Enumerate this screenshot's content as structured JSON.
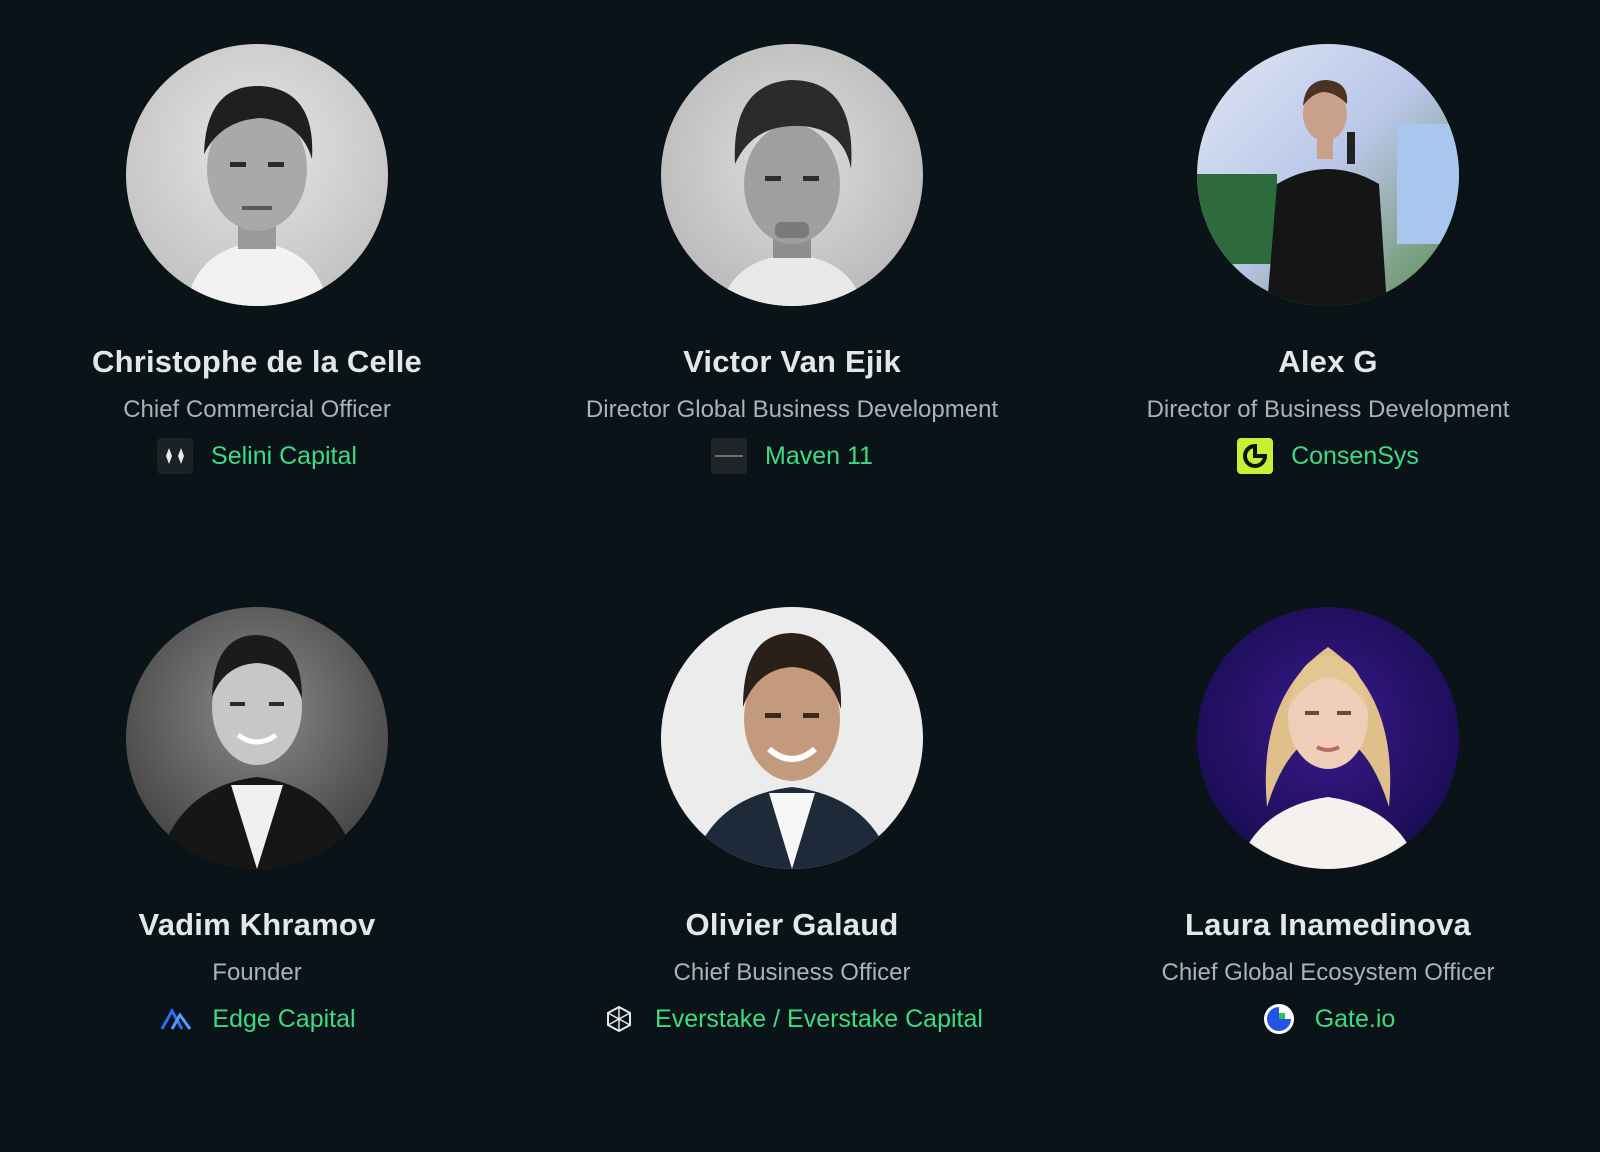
{
  "speakers": [
    {
      "name": "Christophe de la Celle",
      "role": "Chief Commercial Officer",
      "company": "Selini Capital",
      "logo_icon": "selini-capital-logo-icon",
      "photo": "christophe-de-la-celle-photo"
    },
    {
      "name": "Victor Van Ejik",
      "role": "Director Global Business Development",
      "company": "Maven 11",
      "logo_icon": "maven-11-logo-icon",
      "photo": "victor-van-ejik-photo"
    },
    {
      "name": "Alex G",
      "role": "Director of Business Development",
      "company": "ConsenSys",
      "logo_icon": "consensys-logo-icon",
      "photo": "alex-g-photo"
    },
    {
      "name": "Vadim Khramov",
      "role": "Founder",
      "company": "Edge Capital",
      "logo_icon": "edge-capital-logo-icon",
      "photo": "vadim-khramov-photo"
    },
    {
      "name": "Olivier Galaud",
      "role": "Chief Business Officer",
      "company": "Everstake / Everstake Capital",
      "logo_icon": "everstake-logo-icon",
      "photo": "olivier-galaud-photo"
    },
    {
      "name": "Laura Inamedinova",
      "role": "Chief Global Ecosystem Officer",
      "company": "Gate.io",
      "logo_icon": "gate-io-logo-icon",
      "photo": "laura-inamedinova-photo"
    }
  ],
  "colors": {
    "background": "#0a1317",
    "company_link": "#3ddc84",
    "role_text": "#aab3b7",
    "name_text": "#e3e7e9",
    "consensys_brand": "#c6f135",
    "gate_brand": "#2354e6"
  }
}
